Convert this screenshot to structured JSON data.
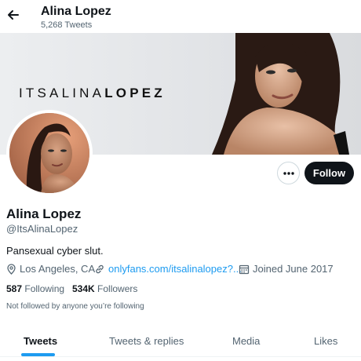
{
  "header": {
    "title": "Alina Lopez",
    "tweet_count": "5,268 Tweets"
  },
  "banner": {
    "text_light": "ITSALINA",
    "text_bold": "LOPEZ"
  },
  "profile": {
    "display_name": "Alina Lopez",
    "handle": "@ItsAlinaLopez",
    "bio": "Pansexual cyber slut.",
    "location": "Los Angeles, CA",
    "website": "onlyfans.com/itsalinalopez?...",
    "joined": "Joined June 2017",
    "following_count": "587",
    "following_label": "Following",
    "followers_count": "534K",
    "followers_label": "Followers",
    "followed_by_note": "Not followed by anyone you’re following"
  },
  "actions": {
    "follow_label": "Follow",
    "more_icon": "more-options-icon"
  },
  "tabs": [
    {
      "label": "Tweets",
      "active": true
    },
    {
      "label": "Tweets & replies",
      "active": false
    },
    {
      "label": "Media",
      "active": false
    },
    {
      "label": "Likes",
      "active": false
    }
  ],
  "colors": {
    "accent": "#1d9bf0",
    "text": "#0f1419",
    "secondary_text": "#536471",
    "follow_button": "#0f1419"
  }
}
